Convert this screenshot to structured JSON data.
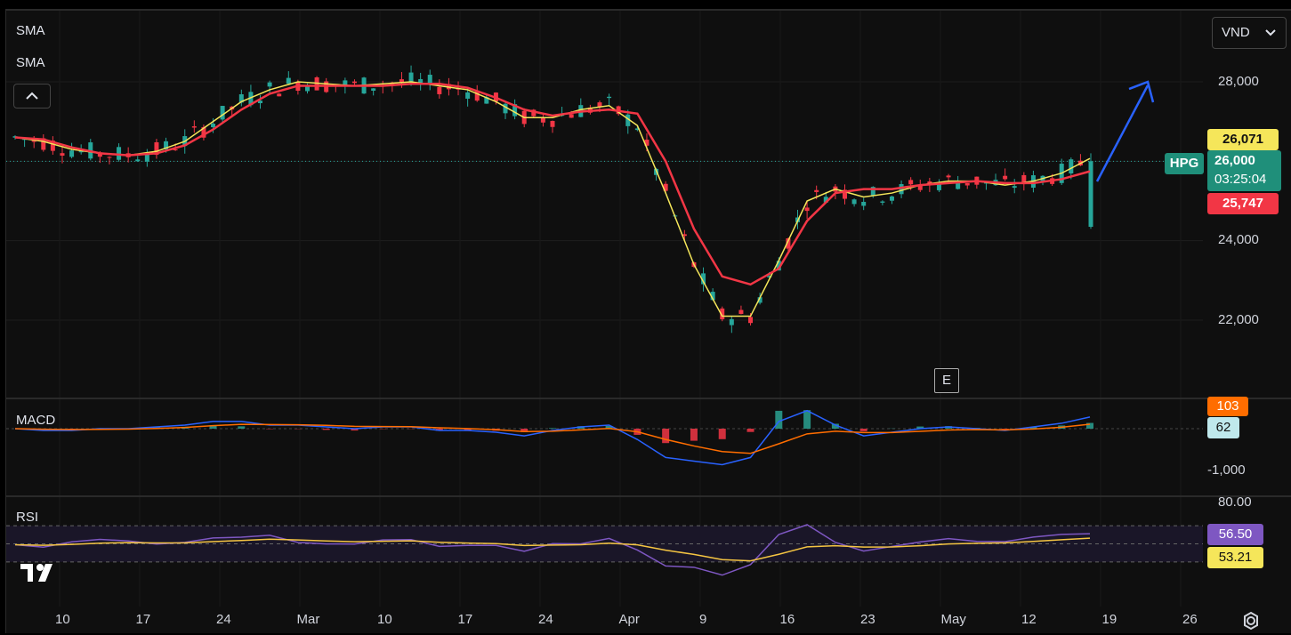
{
  "indicators": {
    "sma1": "SMA",
    "sma2": "SMA",
    "macd": "MACD",
    "rsi": "RSI"
  },
  "currency": {
    "label": "VND",
    "chevron_icon": "chevron-down-icon"
  },
  "collapse_icon": "chevron-up-icon",
  "earnings_marker": "E",
  "symbol": "HPG",
  "price_axis": {
    "ticks": [
      "28,000",
      "26,000",
      "24,000",
      "22,000"
    ],
    "values": [
      28000,
      26000,
      24000,
      22000
    ]
  },
  "price_tags": {
    "sma_fast": "26,071",
    "last": "26,000",
    "countdown": "03:25:04",
    "sma_slow": "25,747"
  },
  "macd_axis": {
    "ticks": [
      "-1,000"
    ],
    "tag_signal": "103",
    "tag_macd": "62"
  },
  "rsi_axis": {
    "ticks": [
      "80.00"
    ],
    "tag_rsi": "56.50",
    "tag_ma": "53.21"
  },
  "time_axis": [
    "10",
    "17",
    "24",
    "Mar",
    "10",
    "17",
    "24",
    "Apr",
    "9",
    "16",
    "23",
    "May",
    "12",
    "19",
    "26"
  ],
  "colors": {
    "up": "#26a69a",
    "down": "#f23645",
    "sma_fast": "#f5e65a",
    "sma_slow": "#f23645",
    "macd": "#2962ff",
    "signal": "#ff6d00",
    "rsi": "#7e57c2",
    "rsi_ma": "#f5c542",
    "arrow": "#2962ff"
  },
  "chart_data": {
    "type": "candlestick",
    "symbol": "HPG",
    "currency": "VND",
    "ylim": [
      21000,
      29000
    ],
    "series": [
      {
        "name": "SMA",
        "values": [
          26600,
          26500,
          26300,
          26200,
          26150,
          26250,
          26500,
          27000,
          27500,
          27800,
          28000,
          27950,
          27900,
          27950,
          28000,
          27900,
          27800,
          27500,
          27100,
          27100,
          27300,
          27400,
          26900,
          25200,
          23400,
          22100,
          22100,
          23500,
          25000,
          25300,
          25100,
          25200,
          25400,
          25500,
          25500,
          25400,
          25500,
          25700,
          26071
        ]
      },
      {
        "name": "SMA",
        "values": [
          26600,
          26550,
          26350,
          26200,
          26150,
          26200,
          26400,
          26800,
          27300,
          27700,
          27900,
          27900,
          27900,
          27900,
          27950,
          27950,
          27850,
          27600,
          27300,
          27150,
          27250,
          27300,
          27200,
          26000,
          24300,
          23100,
          22900,
          23300,
          24500,
          25200,
          25300,
          25300,
          25400,
          25450,
          25500,
          25450,
          25450,
          25550,
          25747
        ]
      }
    ],
    "last_price": 26000,
    "macd": {
      "macd": 103,
      "signal": 62
    },
    "rsi": {
      "rsi": 56.5,
      "ma": 53.21,
      "ylim_top": 80
    }
  }
}
